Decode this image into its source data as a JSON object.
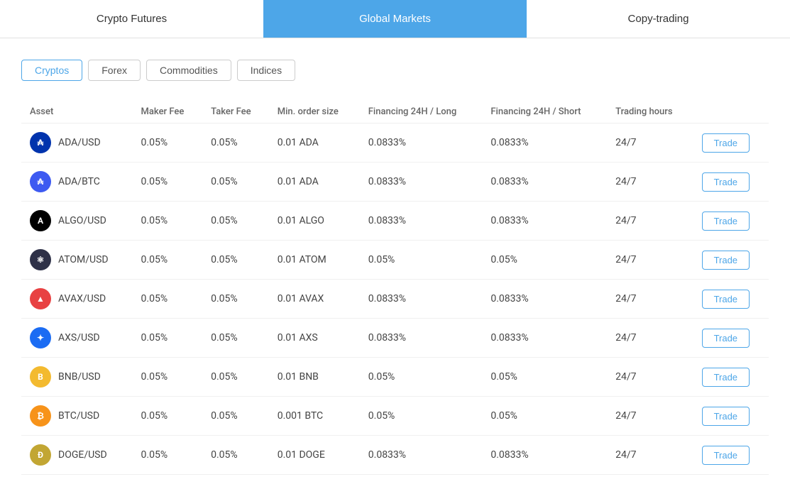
{
  "nav": {
    "tabs": [
      {
        "id": "crypto-futures",
        "label": "Crypto Futures",
        "active": false
      },
      {
        "id": "global-markets",
        "label": "Global Markets",
        "active": true
      },
      {
        "id": "copy-trading",
        "label": "Copy-trading",
        "active": false
      }
    ]
  },
  "filters": {
    "tabs": [
      {
        "id": "cryptos",
        "label": "Cryptos",
        "active": true
      },
      {
        "id": "forex",
        "label": "Forex",
        "active": false
      },
      {
        "id": "commodities",
        "label": "Commodities",
        "active": false
      },
      {
        "id": "indices",
        "label": "Indices",
        "active": false
      }
    ]
  },
  "table": {
    "columns": [
      {
        "id": "asset",
        "label": "Asset"
      },
      {
        "id": "maker-fee",
        "label": "Maker Fee"
      },
      {
        "id": "taker-fee",
        "label": "Taker Fee"
      },
      {
        "id": "min-order",
        "label": "Min. order size"
      },
      {
        "id": "financing-long",
        "label": "Financing 24H / Long"
      },
      {
        "id": "financing-short",
        "label": "Financing 24H / Short"
      },
      {
        "id": "trading-hours",
        "label": "Trading hours"
      },
      {
        "id": "action",
        "label": ""
      }
    ],
    "rows": [
      {
        "asset": "ADA/USD",
        "iconClass": "icon-ada",
        "iconText": "₳",
        "makerFee": "0.05%",
        "takerFee": "0.05%",
        "minOrder": "0.01 ADA",
        "financingLong": "0.0833%",
        "financingShort": "0.0833%",
        "tradingHours": "24/7",
        "tradeLabel": "Trade"
      },
      {
        "asset": "ADA/BTC",
        "iconClass": "icon-ada-btc",
        "iconText": "₳",
        "makerFee": "0.05%",
        "takerFee": "0.05%",
        "minOrder": "0.01 ADA",
        "financingLong": "0.0833%",
        "financingShort": "0.0833%",
        "tradingHours": "24/7",
        "tradeLabel": "Trade"
      },
      {
        "asset": "ALGO/USD",
        "iconClass": "icon-algo",
        "iconText": "A",
        "makerFee": "0.05%",
        "takerFee": "0.05%",
        "minOrder": "0.01 ALGO",
        "financingLong": "0.0833%",
        "financingShort": "0.0833%",
        "tradingHours": "24/7",
        "tradeLabel": "Trade"
      },
      {
        "asset": "ATOM/USD",
        "iconClass": "icon-atom",
        "iconText": "⚛",
        "makerFee": "0.05%",
        "takerFee": "0.05%",
        "minOrder": "0.01 ATOM",
        "financingLong": "0.05%",
        "financingShort": "0.05%",
        "tradingHours": "24/7",
        "tradeLabel": "Trade"
      },
      {
        "asset": "AVAX/USD",
        "iconClass": "icon-avax",
        "iconText": "▲",
        "makerFee": "0.05%",
        "takerFee": "0.05%",
        "minOrder": "0.01 AVAX",
        "financingLong": "0.0833%",
        "financingShort": "0.0833%",
        "tradingHours": "24/7",
        "tradeLabel": "Trade"
      },
      {
        "asset": "AXS/USD",
        "iconClass": "icon-axs",
        "iconText": "✦",
        "makerFee": "0.05%",
        "takerFee": "0.05%",
        "minOrder": "0.01 AXS",
        "financingLong": "0.0833%",
        "financingShort": "0.0833%",
        "tradingHours": "24/7",
        "tradeLabel": "Trade"
      },
      {
        "asset": "BNB/USD",
        "iconClass": "icon-bnb",
        "iconText": "B",
        "makerFee": "0.05%",
        "takerFee": "0.05%",
        "minOrder": "0.01 BNB",
        "financingLong": "0.05%",
        "financingShort": "0.05%",
        "tradingHours": "24/7",
        "tradeLabel": "Trade"
      },
      {
        "asset": "BTC/USD",
        "iconClass": "icon-btc",
        "iconText": "₿",
        "makerFee": "0.05%",
        "takerFee": "0.05%",
        "minOrder": "0.001 BTC",
        "financingLong": "0.05%",
        "financingShort": "0.05%",
        "tradingHours": "24/7",
        "tradeLabel": "Trade"
      },
      {
        "asset": "DOGE/USD",
        "iconClass": "icon-doge",
        "iconText": "Ð",
        "makerFee": "0.05%",
        "takerFee": "0.05%",
        "minOrder": "0.01 DOGE",
        "financingLong": "0.0833%",
        "financingShort": "0.0833%",
        "tradingHours": "24/7",
        "tradeLabel": "Trade"
      }
    ]
  }
}
